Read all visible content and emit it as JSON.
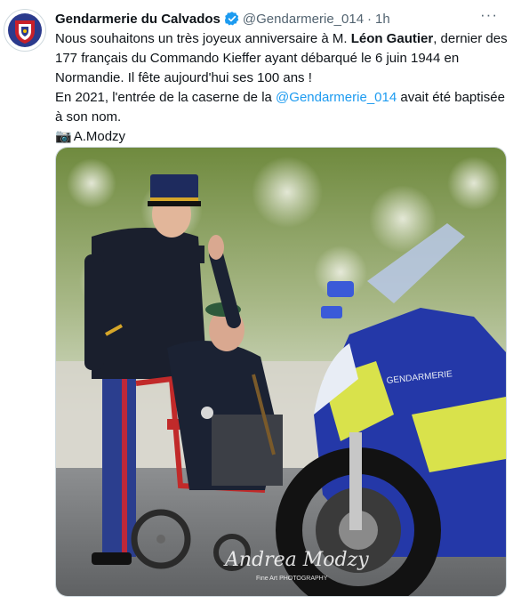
{
  "tweet": {
    "author_name": "Gendarmerie du Calvados",
    "handle": "@Gendarmerie_014",
    "separator": "·",
    "time": "1h",
    "more_label": "···",
    "line1_pre": "Nous souhaitons un très joyeux anniversaire à M. ",
    "line1_bold": "Léon Gautier",
    "line1_post": ", dernier des",
    "line2": "177 français du Commando Kieffer ayant débarqué le 6 juin 1944 en",
    "line3": "Normandie. Il fête aujourd'hui ses 100 ans !",
    "line4_pre": "En 2021, l'entrée de la caserne de la ",
    "line4_mention": "@Gendarmerie_014",
    "line4_post": " avait été baptisée",
    "line5": "à son nom.",
    "line6_camera": "📷",
    "line6_credit": "A.Modzy",
    "photo_signature": "Andrea Modzy",
    "photo_signature_sub": "Fine Art PHOTOGRAPHY"
  },
  "colors": {
    "verified": "#1d9bf0",
    "mention": "#1d9bf0",
    "secondary": "#536471",
    "text": "#0f1419"
  },
  "icons": {
    "verified": "verified-badge-icon",
    "avatar": "gendarmerie-crest-icon",
    "more": "more-options-icon"
  }
}
